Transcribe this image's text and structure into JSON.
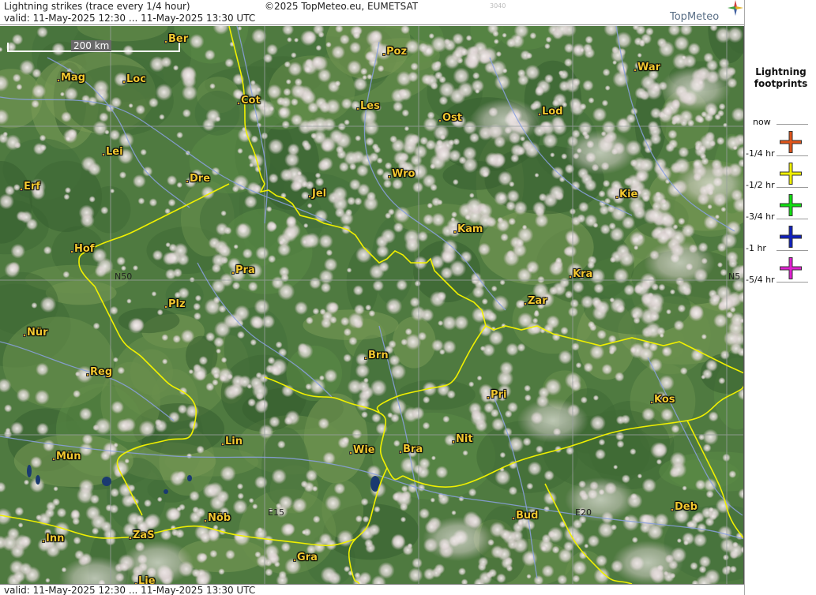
{
  "header": {
    "title": "Lightning strikes (trace every 1/4 hour)",
    "valid": "valid:  11-May-2025 12:30 ... 11-May-2025 13:30 UTC",
    "copyright": "©2025 TopMeteo.eu, EUMETSAT",
    "tag": "3040",
    "logo": "TopMeteo"
  },
  "map": {
    "scale_label": "200 km",
    "grid_labels": [
      "N50",
      "N5",
      "E15",
      "E20"
    ],
    "cities": [
      "Ber",
      "Poz",
      "War",
      "Mag",
      "Loc",
      "Cot",
      "Les",
      "Ost",
      "Lod",
      "Lei",
      "Dre",
      "Wro",
      "Erf",
      "Jel",
      "Kie",
      "Kam",
      "Hof",
      "Pra",
      "Kra",
      "Plz",
      "Zar",
      "Nür",
      "Brn",
      "Reg",
      "Pri",
      "Kos",
      "Lin",
      "Nit",
      "Wie",
      "Bra",
      "Mün",
      "Nöb",
      "Bud",
      "Deb",
      "Inn",
      "ZaS",
      "Gra",
      "Lie"
    ]
  },
  "footer": {
    "valid": "valid:  11-May-2025 12:30 ... 11-May-2025 13:30 UTC"
  },
  "legend": {
    "title_line1": "Lightning",
    "title_line2": "footprints",
    "items": [
      {
        "label": "now",
        "color": ""
      },
      {
        "label": "-1/4 hr",
        "color": "#e0541a"
      },
      {
        "label": "-1/2 hr",
        "color": "#f0f000"
      },
      {
        "label": "-3/4 hr",
        "color": "#10e010"
      },
      {
        "label": "-1 hr",
        "color": "#1020c0"
      },
      {
        "label": "-5/4 hr",
        "color": "#e020d0"
      }
    ]
  },
  "colors": {
    "border": "#f0f000",
    "river": "#8aa0e0",
    "grid": "#9aa0a0",
    "city_label": "#f2c830"
  }
}
